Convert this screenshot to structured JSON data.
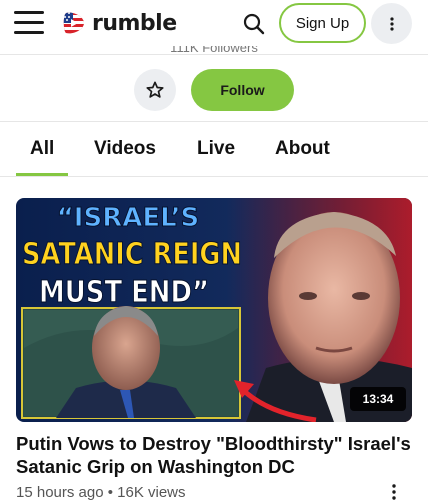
{
  "header": {
    "logo_text": "rumble",
    "signup_label": "Sign Up"
  },
  "channel": {
    "followers_text": "111K Followers",
    "follow_label": "Follow"
  },
  "tabs": [
    {
      "label": "All",
      "active": true
    },
    {
      "label": "Videos",
      "active": false
    },
    {
      "label": "Live",
      "active": false
    },
    {
      "label": "About",
      "active": false
    }
  ],
  "video": {
    "thumbnail_text": {
      "line1": "“ISRAEL’S",
      "line2": "SATANIC REIGN",
      "line3": "MUST END”"
    },
    "duration": "13:34",
    "title": "Putin Vows to Destroy \"Bloodthirsty\" Israel's Satanic Grip on Washington DC",
    "meta": "15 hours ago • 16K  views"
  },
  "colors": {
    "accent": "#85c742",
    "chip_bg": "#eceef1",
    "thumb_line1": "#5fb3ff",
    "thumb_line2": "#ffd21f",
    "thumb_line3": "#ffffff",
    "thumb_bg": "#0a1a3a"
  },
  "icons": [
    "menu-icon",
    "rumble-logo-icon",
    "search-icon",
    "more-vertical-icon",
    "star-icon",
    "kebab-icon"
  ]
}
